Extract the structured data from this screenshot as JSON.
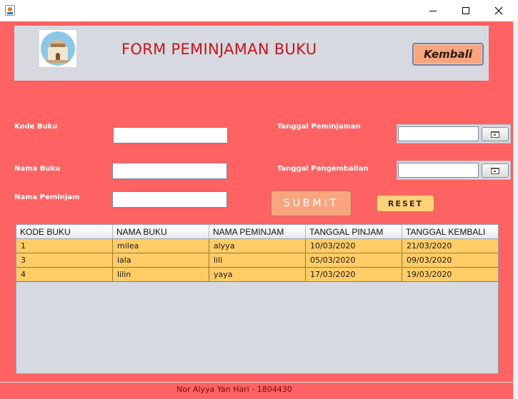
{
  "window": {
    "app_icon": "java-cup-icon",
    "minimize_icon": "minimize-icon",
    "maximize_icon": "maximize-icon",
    "close_icon": "close-icon"
  },
  "header": {
    "logo_icon": "library-logo-icon",
    "title": "FORM PEMINJAMAN BUKU",
    "back_label": "Kembali"
  },
  "form": {
    "kode_buku_label": "Kode Buku",
    "nama_buku_label": "Nama Buku",
    "nama_peminjam_label": "Nama Peminjam",
    "tanggal_peminjaman_label": "Tanggal Peminjaman",
    "tanggal_pengembalian_label": "Tanggal Pengembalian",
    "kode_buku_value": "",
    "nama_buku_value": "",
    "nama_peminjam_value": "",
    "tanggal_peminjaman_value": "",
    "tanggal_pengembalian_value": "",
    "submit_label": "SUBMIT",
    "reset_label": "RESET",
    "calendar_icon": "calendar-icon"
  },
  "table": {
    "columns": [
      "KODE BUKU",
      "NAMA BUKU",
      "NAMA PEMINJAM",
      "TANGGAL PINJAM",
      "TANGGAL KEMBALI"
    ],
    "rows": [
      [
        "1",
        "milea",
        "alyya",
        "10/03/2020",
        "21/03/2020"
      ],
      [
        "3",
        "lala",
        "lili",
        "05/03/2020",
        "09/03/2020"
      ],
      [
        "4",
        "lilin",
        "yaya",
        "17/03/2020",
        "19/03/2020"
      ]
    ]
  },
  "footer": {
    "text": "Nor Alyya Yan Hari - 1804430"
  },
  "colors": {
    "background": "#ff6262",
    "panel": "#d6d9e0",
    "title": "#c8141e",
    "button_peach": "#f9a57d",
    "button_yellow": "#ffd27a",
    "row": "#ffcc66"
  }
}
